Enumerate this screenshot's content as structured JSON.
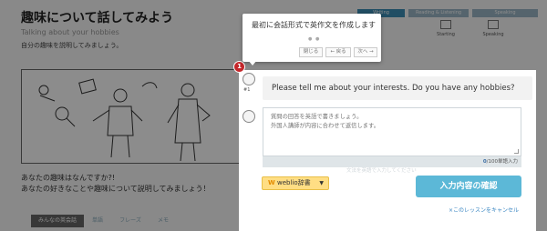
{
  "lesson": {
    "title": "趣味について話してみよう",
    "subtitle": "Talking about your hobbies",
    "instruction": "自分の趣味を説明してみましょう。",
    "question_line1": "あなたの趣味はなんですか?!",
    "question_line2": "あなたの好きなことや趣味について説明してみましょう！"
  },
  "steps": [
    "Writing",
    "Reading & Listening",
    "Speaking"
  ],
  "side_tools": [
    "Starting",
    "Speaking"
  ],
  "tabs": [
    "みんなの英会話",
    "単語",
    "フレーズ",
    "メモ"
  ],
  "tooltip": {
    "text": "最初に会話形式で英作文を作成します",
    "dots": "● ●",
    "close_label": "閉じる",
    "back_label": "← 戻る",
    "next_label": "次へ →"
  },
  "badge": "1",
  "avatar_tag": "#1",
  "prompt": "Please tell me about your interests. Do you have any hobbies?",
  "answer": {
    "placeholder": "質問の回答を英語で書きましょう。\n外国人講師が内容に合わせて返信します。"
  },
  "counter": {
    "current": "0",
    "limit_text": "/100単語入力"
  },
  "hint": "文法を英語で入力してください",
  "dictionary_button": {
    "logo": "W",
    "label": "weblio辞書",
    "caret": "▼"
  },
  "confirm_button": "入力内容の確認",
  "cancel_link": "×このレッスンをキャンセル",
  "colors": {
    "accent": "#5cb8d7",
    "badge": "#c4272b",
    "dictionary": "#ffde84",
    "link": "#3a86c2"
  }
}
